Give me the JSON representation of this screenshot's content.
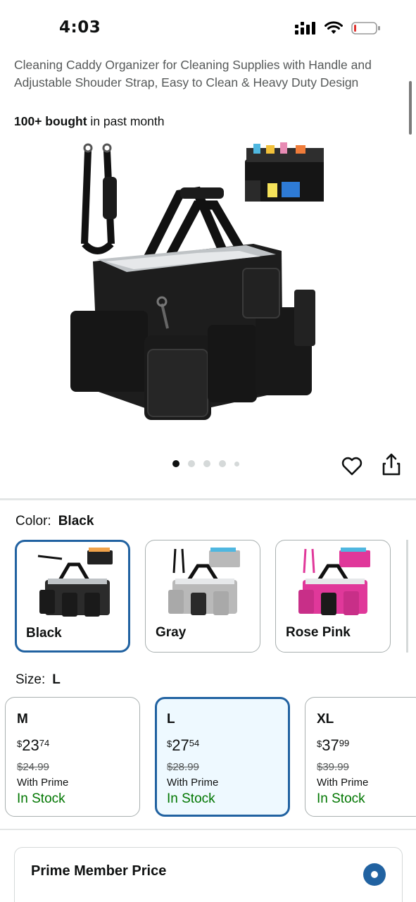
{
  "status_bar": {
    "time": "4:03",
    "icons": [
      "signal-icon",
      "wifi-icon",
      "battery-icon"
    ]
  },
  "product": {
    "title": "Cleaning Caddy Organizer for Cleaning Supplies with Handle and Adjustable Shouder Strap, Easy to Clean & Heavy Duty Design",
    "bought_bold": "100+ bought",
    "bought_rest": " in past month"
  },
  "carousel": {
    "total": 5,
    "active": 0
  },
  "actions": {
    "favorite": "heart-icon",
    "share": "share-icon"
  },
  "color": {
    "label": "Color:",
    "selected": "Black",
    "options": [
      {
        "name": "Black",
        "swatch": "#2b2b2b",
        "accent": "#1a1a1a"
      },
      {
        "name": "Gray",
        "swatch": "#b9b9b9",
        "accent": "#1a1a1a"
      },
      {
        "name": "Rose Pink",
        "swatch": "#e0389a",
        "accent": "#1a1a1a"
      }
    ]
  },
  "size": {
    "label": "Size:",
    "selected": "L",
    "options": [
      {
        "size": "M",
        "symbol": "$",
        "whole": "23",
        "fraction": "74",
        "list_price": "$24.99",
        "prime": "With Prime",
        "stock": "In Stock"
      },
      {
        "size": "L",
        "symbol": "$",
        "whole": "27",
        "fraction": "54",
        "list_price": "$28.99",
        "prime": "With Prime",
        "stock": "In Stock"
      },
      {
        "size": "XL",
        "symbol": "$",
        "whole": "37",
        "fraction": "99",
        "list_price": "$39.99",
        "prime": "With Prime",
        "stock": "In Stock"
      }
    ]
  },
  "prime_card": {
    "title": "Prime Member Price"
  },
  "colors": {
    "accent": "#2162a1",
    "stock_green": "#007600",
    "muted_text": "#565959",
    "selected_bg": "#eef9ff"
  }
}
